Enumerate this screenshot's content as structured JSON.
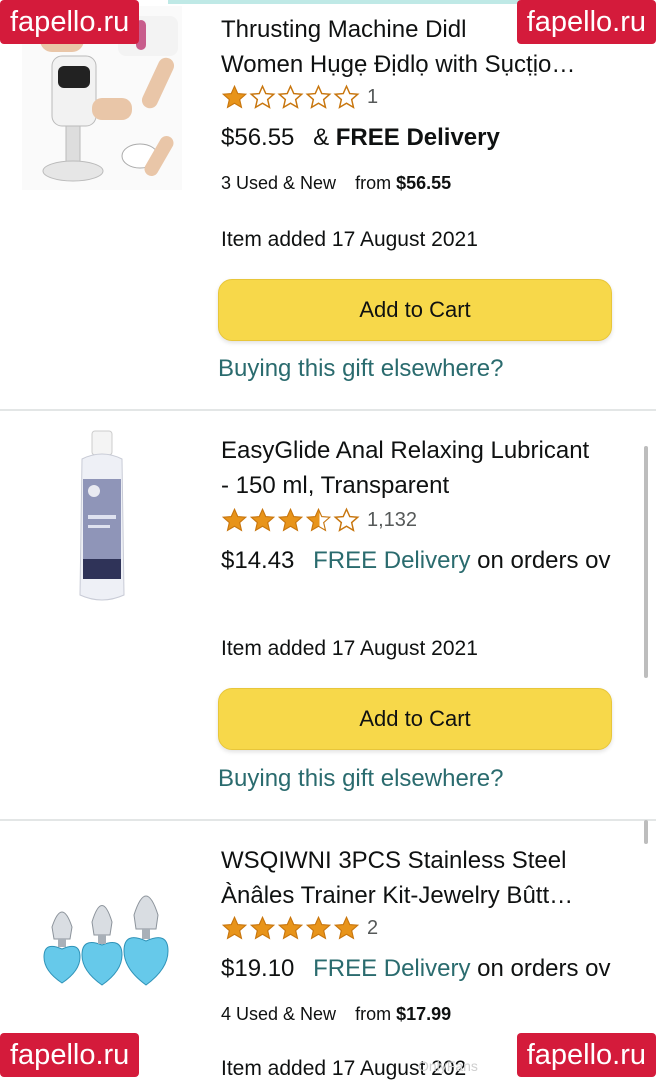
{
  "items": [
    {
      "title_lines": [
        "Thrusting Machine Didl",
        "Women Hụgẹ Địdlọ with Sụcṭịo…"
      ],
      "rating_stars": 1,
      "rating_count": "1",
      "price": "$56.55",
      "delivery_prefix": "&",
      "delivery_text": "FREE Delivery",
      "delivery_suffix": "",
      "used_label": "3 Used & New",
      "used_from": "from",
      "used_price": "$56.55",
      "added": "Item added 17 August 2021",
      "cart_label": "Add to Cart",
      "gift_label": "Buying this gift elsewhere?"
    },
    {
      "title_lines": [
        "EasyGlide Anal Relaxing Lubricant",
        "- 150 ml, Transparent"
      ],
      "rating_stars": 4,
      "rating_count": "1,132",
      "price": "$14.43",
      "delivery_prefix": "",
      "delivery_text": "FREE Delivery",
      "delivery_suffix": "on orders ov",
      "added": "Item added 17 August 2021",
      "cart_label": "Add to Cart",
      "gift_label": "Buying this gift elsewhere?"
    },
    {
      "title_lines": [
        "WSQIWNI 3PCS Stainless Steel",
        "Ànâles Trainer Kit-Jewelry Bûtt…"
      ],
      "rating_stars": 5,
      "rating_count": "2",
      "price": "$19.10",
      "delivery_prefix": "",
      "delivery_text": "FREE Delivery",
      "delivery_suffix": "on orders ov",
      "used_label": "4 Used & New",
      "used_from": "from",
      "used_price": "$17.99",
      "added": "Item added 17 August 202"
    }
  ],
  "watermark": {
    "badge_text": "fapello.ru",
    "faint_text": "OnlyFans"
  },
  "colors": {
    "cart_button": "#f7d84a",
    "link": "#2a6b6e",
    "star": "#e8941a",
    "badge": "#d41b3b"
  }
}
